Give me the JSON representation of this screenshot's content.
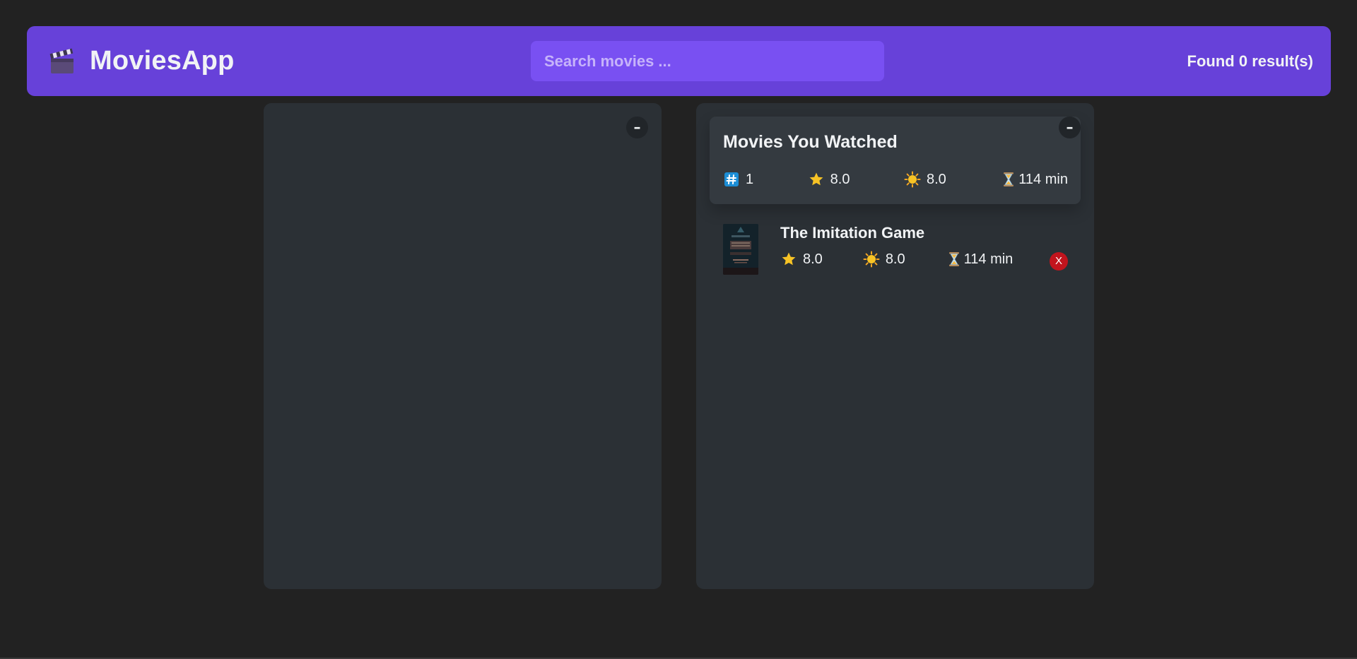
{
  "navbar": {
    "logo_icon": "clapperboard-icon",
    "app_name": "MoviesApp",
    "search": {
      "placeholder": "Search movies ...",
      "value": ""
    },
    "results_text": "Found 0 result(s)",
    "accent_color": "#6741d9"
  },
  "left_box": {
    "toggle_label": "–",
    "movies": []
  },
  "right_box": {
    "toggle_label": "–",
    "summary": {
      "title": "Movies You Watched",
      "movies_count": "1",
      "avg_imdb_rating": "8.0",
      "avg_user_rating": "8.0",
      "avg_runtime": "114 min"
    },
    "watched": [
      {
        "title": "The Imitation Game",
        "imdb_rating": "8.0",
        "user_rating": "8.0",
        "runtime": "114 min",
        "delete_label": "X"
      }
    ]
  },
  "icons": {
    "count": "hash-icon",
    "imdb": "star-icon",
    "user": "sun-icon",
    "runtime": "hourglass-icon"
  }
}
